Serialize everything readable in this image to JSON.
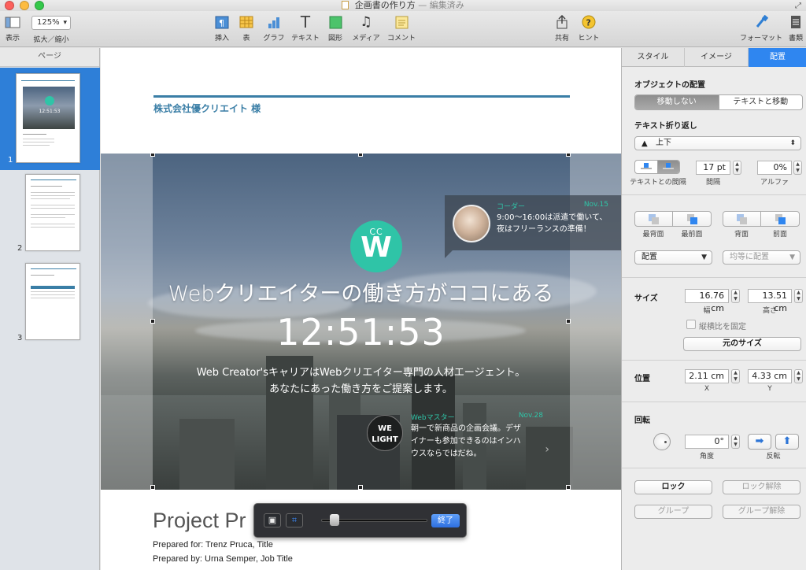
{
  "window": {
    "title": "企画書の作り方",
    "edited": "— 編集済み"
  },
  "toolbar": {
    "view_label": "表示",
    "zoom_value": "125%",
    "zoom_label": "拡大／縮小",
    "insert_label": "挿入",
    "table_label": "表",
    "chart_label": "グラフ",
    "text_label": "テキスト",
    "shape_label": "図形",
    "media_label": "メディア",
    "comment_label": "コメント",
    "share_label": "共有",
    "tips_label": "ヒント",
    "format_label": "フォーマット",
    "document_label": "書類"
  },
  "sidebar": {
    "header": "ページ",
    "pages": [
      "1",
      "2",
      "3"
    ]
  },
  "document": {
    "client": "株式会社優クリエイト 様",
    "logo_cc": "CC",
    "logo_w": "W",
    "headline": "Webクリエイターの働き方がココにある",
    "clock": "12:51:53",
    "tagline_1": "Web Creator'sキャリアはWebクリエイター専門の人材エージェント。",
    "tagline_2": "あなたにあった働き方をご提案します。",
    "bubble": {
      "name": "コーダー",
      "date": "Nov.15",
      "line1": "9:00〜16:00は派遣で働いて、",
      "line2": "夜はフリーランスの準備！"
    },
    "note": {
      "avatar_text": "WE LIGHT",
      "name": "Webマスター",
      "date": "Nov.28",
      "line1": "朝一で新商品の企画会議。デザ",
      "line2": "イナーも参加できるのはインハ",
      "line3": "ウスならではだね。"
    },
    "project_title": "Project Pr",
    "prepared_for": "Prepared for: Trenz Pruca, Title",
    "prepared_by": "Prepared by: Urna Semper, Job Title"
  },
  "mask_bar": {
    "done_label": "終了",
    "zoom_level": 0.06
  },
  "inspector": {
    "tabs": [
      "スタイル",
      "イメージ",
      "配置"
    ],
    "active_tab": "配置",
    "object_placement": {
      "title": "オブジェクトの配置",
      "options": [
        "移動しない",
        "テキストと移動"
      ],
      "selected": "移動しない"
    },
    "text_wrap": {
      "title": "テキスト折り返し",
      "value": "上下",
      "spacing_label": "テキストとの間隔",
      "gap_value": "17 pt",
      "gap_label": "間隔",
      "alpha_value": "0%",
      "alpha_label": "アルファ"
    },
    "arrange": {
      "back_most": "最背面",
      "front_most": "最前面",
      "back": "背面",
      "front": "前面",
      "align_value": "配置",
      "distribute_value": "均等に配置"
    },
    "size": {
      "title": "サイズ",
      "width": "16.76 cm",
      "width_label": "幅",
      "height": "13.51 cm",
      "height_label": "高さ",
      "constrain_label": "縦横比を固定",
      "original_size": "元のサイズ"
    },
    "position": {
      "title": "位置",
      "x": "2.11 cm",
      "x_label": "X",
      "y": "4.33 cm",
      "y_label": "Y"
    },
    "rotate": {
      "title": "回転",
      "angle": "0°",
      "angle_label": "角度",
      "flip_label": "反転"
    },
    "lock": {
      "lock": "ロック",
      "unlock": "ロック解除"
    },
    "group": {
      "group": "グループ",
      "ungroup": "グループ解除"
    },
    "colors": {
      "accent": "#2f86f0",
      "brand_teal": "#2fc4a7"
    }
  }
}
